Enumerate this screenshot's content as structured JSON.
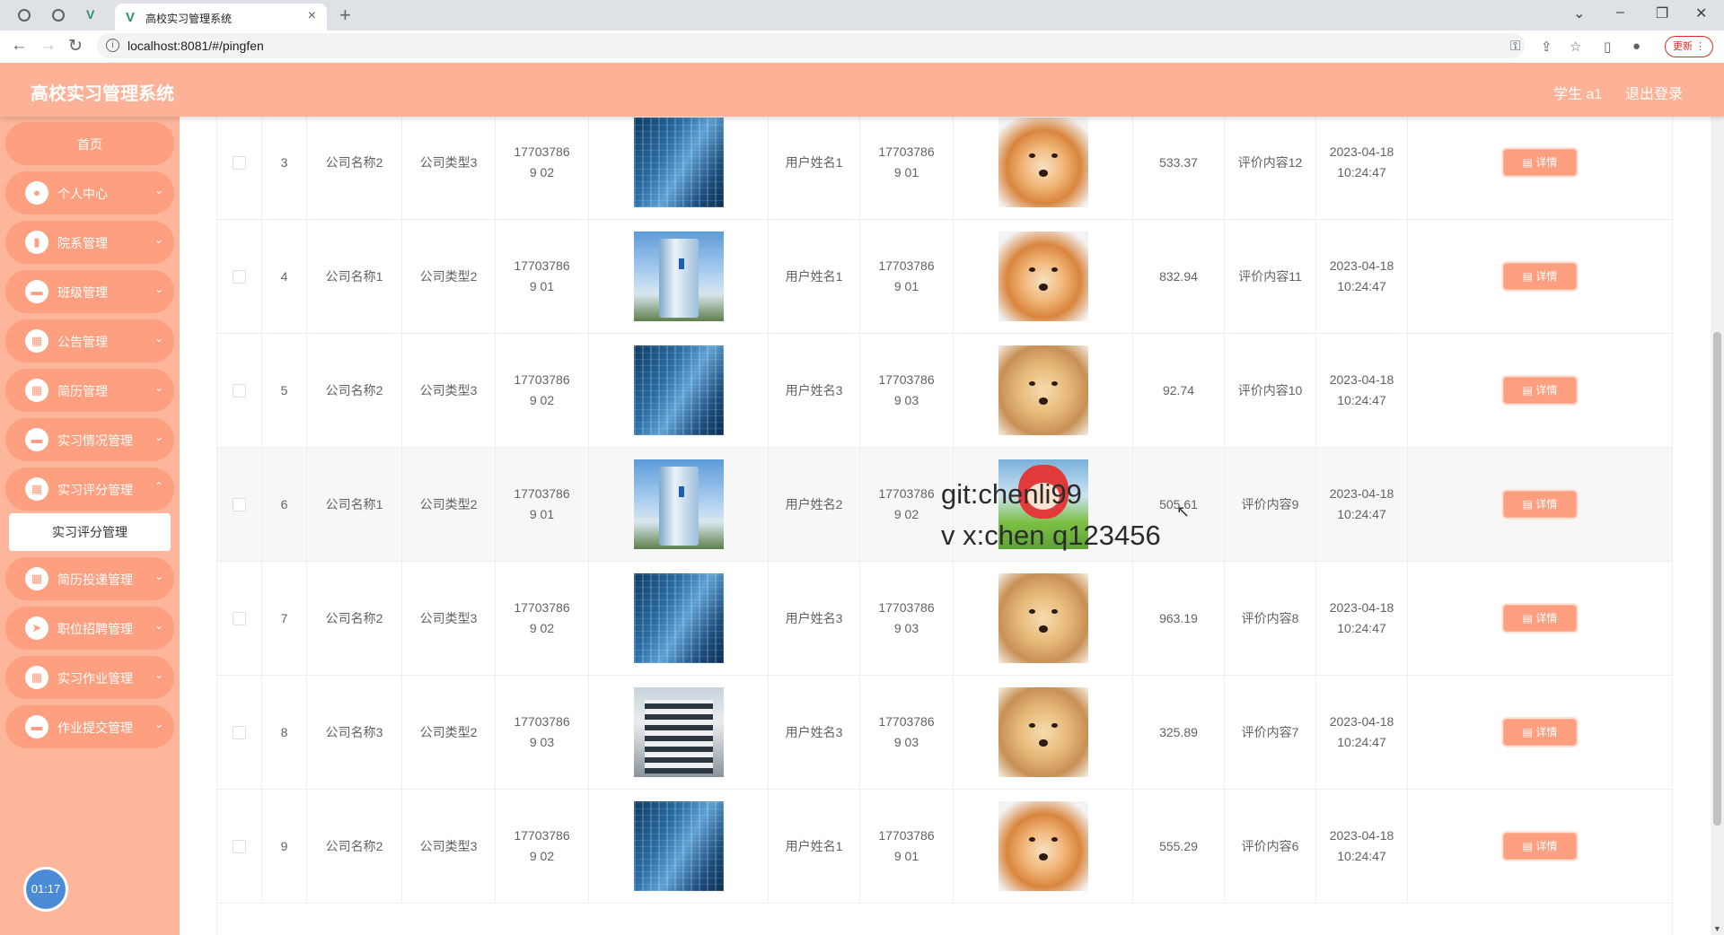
{
  "browser": {
    "tab_title": "高校实习管理系统",
    "url": "localhost:8081/#/pingfen",
    "update_label": "更新"
  },
  "header": {
    "title": "高校实习管理系统",
    "user": "学生 a1",
    "logout": "退出登录"
  },
  "sidebar": {
    "items": [
      {
        "label": "首页",
        "icon": "home-icon"
      },
      {
        "label": "个人中心",
        "icon": "user-icon"
      },
      {
        "label": "院系管理",
        "icon": "chart-icon"
      },
      {
        "label": "班级管理",
        "icon": "monitor-icon"
      },
      {
        "label": "公告管理",
        "icon": "grid-icon"
      },
      {
        "label": "简历管理",
        "icon": "grid-icon"
      },
      {
        "label": "实习情况管理",
        "icon": "monitor-icon"
      },
      {
        "label": "实习评分管理",
        "icon": "grid-icon"
      },
      {
        "label": "简历投递管理",
        "icon": "grid-icon"
      },
      {
        "label": "职位招聘管理",
        "icon": "send-icon"
      },
      {
        "label": "实习作业管理",
        "icon": "grid-icon"
      },
      {
        "label": "作业提交管理",
        "icon": "monitor-icon"
      }
    ],
    "submenu_active": "实习评分管理",
    "timer": "01:17"
  },
  "table": {
    "detail_label": "详情",
    "rows": [
      {
        "index": "3",
        "company": "公司名称2",
        "type": "公司类型3",
        "acc1": "177037869 02",
        "user": "用户姓名1",
        "acc2": "177037869 01",
        "score": "533.37",
        "comment": "评价内容12",
        "date": "2023-04-18",
        "time": "10:24:47"
      },
      {
        "index": "4",
        "company": "公司名称1",
        "type": "公司类型2",
        "acc1": "177037869 01",
        "user": "用户姓名1",
        "acc2": "177037869 01",
        "score": "832.94",
        "comment": "评价内容11",
        "date": "2023-04-18",
        "time": "10:24:47"
      },
      {
        "index": "5",
        "company": "公司名称2",
        "type": "公司类型3",
        "acc1": "177037869 02",
        "user": "用户姓名3",
        "acc2": "177037869 03",
        "score": "92.74",
        "comment": "评价内容10",
        "date": "2023-04-18",
        "time": "10:24:47"
      },
      {
        "index": "6",
        "company": "公司名称1",
        "type": "公司类型2",
        "acc1": "177037869 01",
        "user": "用户姓名2",
        "acc2": "177037869 02",
        "score": "505.61",
        "comment": "评价内容9",
        "date": "2023-04-18",
        "time": "10:24:47"
      },
      {
        "index": "7",
        "company": "公司名称2",
        "type": "公司类型3",
        "acc1": "177037869 02",
        "user": "用户姓名3",
        "acc2": "177037869 03",
        "score": "963.19",
        "comment": "评价内容8",
        "date": "2023-04-18",
        "time": "10:24:47"
      },
      {
        "index": "8",
        "company": "公司名称3",
        "type": "公司类型2",
        "acc1": "177037869 03",
        "user": "用户姓名3",
        "acc2": "177037869 03",
        "score": "325.89",
        "comment": "评价内容7",
        "date": "2023-04-18",
        "time": "10:24:47"
      },
      {
        "index": "9",
        "company": "公司名称2",
        "type": "公司类型3",
        "acc1": "177037869 02",
        "user": "用户姓名1",
        "acc2": "177037869 01",
        "score": "555.29",
        "comment": "评价内容6",
        "date": "2023-04-18",
        "time": "10:24:47"
      }
    ]
  },
  "watermark": {
    "line1": "git:chenli99",
    "line2": "v x:chen q123456"
  }
}
